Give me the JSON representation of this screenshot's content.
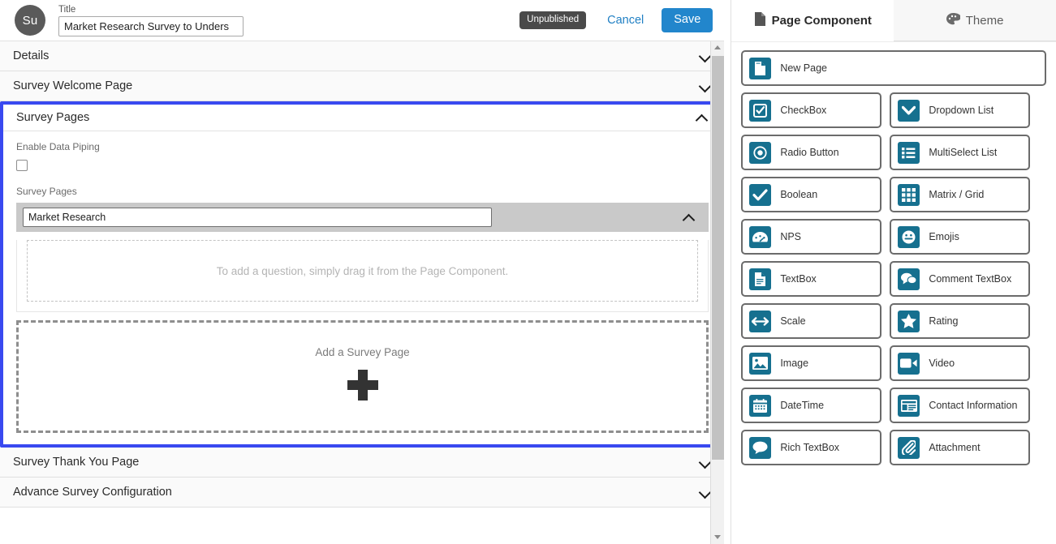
{
  "topbar": {
    "avatar_initials": "Su",
    "title_label": "Title",
    "title_value": "Market Research Survey to Unders",
    "status_badge": "Unpublished",
    "cancel_label": "Cancel",
    "save_label": "Save"
  },
  "accordion": {
    "sections": [
      {
        "label": "Details",
        "expanded": false
      },
      {
        "label": "Survey Welcome Page",
        "expanded": false
      },
      {
        "label": "Survey Pages",
        "expanded": true
      },
      {
        "label": "Survey Thank You Page",
        "expanded": false
      },
      {
        "label": "Advance Survey Configuration",
        "expanded": false
      }
    ]
  },
  "survey_pages": {
    "enable_data_piping_label": "Enable Data Piping",
    "enable_data_piping_checked": false,
    "pages_label": "Survey Pages",
    "page_name_value": "Market Research",
    "question_dropzone_text": "To add a question, simply drag it from the Page Component.",
    "add_page_text": "Add a Survey Page",
    "add_page_icon": "plus-icon"
  },
  "right_panel": {
    "tabs": [
      {
        "label": "Page Component",
        "icon": "page-icon",
        "active": true
      },
      {
        "label": "Theme",
        "icon": "palette-icon",
        "active": false
      }
    ],
    "components": [
      {
        "label": "New Page",
        "icon": "new-page-icon",
        "full_width": true
      },
      {
        "label": "CheckBox",
        "icon": "checkbox-icon",
        "full_width": false
      },
      {
        "label": "Dropdown List",
        "icon": "chevron-down-icon",
        "full_width": false
      },
      {
        "label": "Radio Button",
        "icon": "radio-button-icon",
        "full_width": false
      },
      {
        "label": "MultiSelect List",
        "icon": "list-icon",
        "full_width": false
      },
      {
        "label": "Boolean",
        "icon": "check-icon",
        "full_width": false
      },
      {
        "label": "Matrix / Grid",
        "icon": "grid-icon",
        "full_width": false
      },
      {
        "label": "NPS",
        "icon": "gauge-icon",
        "full_width": false
      },
      {
        "label": "Emojis",
        "icon": "smiley-icon",
        "full_width": false
      },
      {
        "label": "TextBox",
        "icon": "document-icon",
        "full_width": false
      },
      {
        "label": "Comment TextBox",
        "icon": "comments-icon",
        "full_width": false
      },
      {
        "label": "Scale",
        "icon": "arrows-horizontal-icon",
        "full_width": false
      },
      {
        "label": "Rating",
        "icon": "star-icon",
        "full_width": false
      },
      {
        "label": "Image",
        "icon": "image-icon",
        "full_width": false
      },
      {
        "label": "Video",
        "icon": "video-camera-icon",
        "full_width": false
      },
      {
        "label": "DateTime",
        "icon": "calendar-icon",
        "full_width": false
      },
      {
        "label": "Contact Information",
        "icon": "address-card-icon",
        "full_width": false
      },
      {
        "label": "Rich TextBox",
        "icon": "comment-icon",
        "full_width": false
      },
      {
        "label": "Attachment",
        "icon": "paperclip-icon",
        "full_width": false
      }
    ]
  },
  "colors": {
    "accent_blue": "#2286cc",
    "highlight_border": "#3949f0",
    "icon_teal": "#16708f",
    "badge_gray": "#4a4a4a"
  }
}
